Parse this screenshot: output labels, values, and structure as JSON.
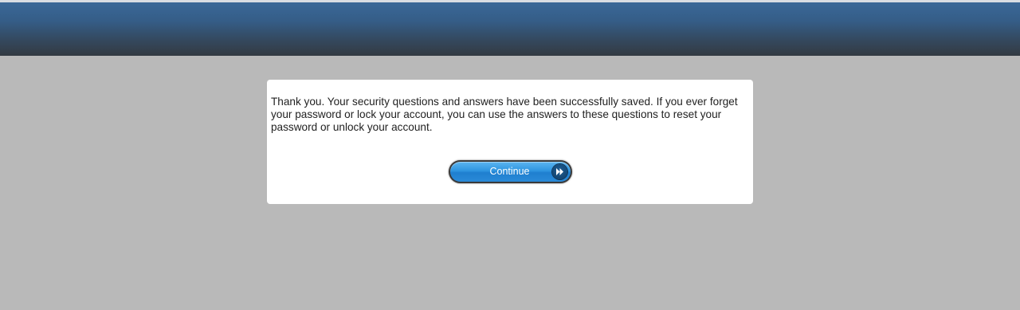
{
  "dialog": {
    "message": "Thank you. Your security questions and answers have been successfully saved. If you ever forget your password or lock your account, you can use the answers to these questions to reset your password or unlock your account.",
    "continue_label": "Continue",
    "continue_icon": "fast-forward-icon"
  },
  "colors": {
    "page_background": "#b9b9b9",
    "header_top": "#3a6898",
    "header_bottom": "#333a42",
    "button_blue": "#2f95e0",
    "dialog_background": "#ffffff"
  }
}
